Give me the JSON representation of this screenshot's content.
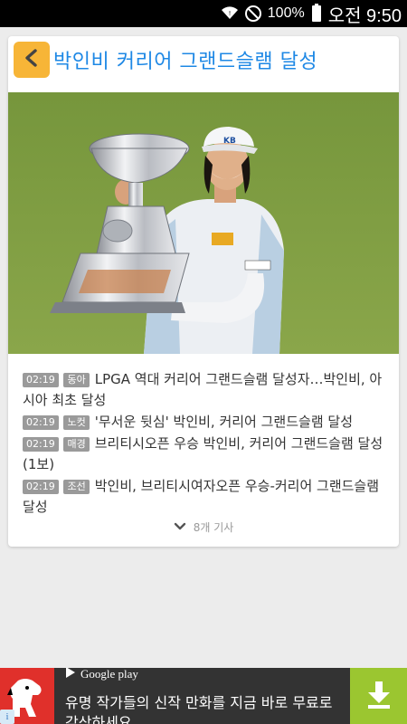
{
  "status_bar": {
    "battery_text": "100%",
    "clock": "오전 9:50",
    "icons": [
      "wifi-icon",
      "no-sim-icon",
      "battery-icon"
    ]
  },
  "card": {
    "title": "박인비 커리어 그랜드슬램 달성",
    "back_icon": "chevron-left-icon",
    "hero_image": "photo-golfer-with-trophy"
  },
  "news": [
    {
      "time": "02:19",
      "source": "동아",
      "headline": "LPGA 역대 커리어 그랜드슬램 달성자…박인비, 아시아 최초 달성"
    },
    {
      "time": "02:19",
      "source": "노컷",
      "headline": "'무서운 뒷심' 박인비, 커리어 그랜드슬램 달성"
    },
    {
      "time": "02:19",
      "source": "매경",
      "headline": "브리티시오픈 우승 박인비, 커리어 그랜드슬램 달성(1보)"
    },
    {
      "time": "02:19",
      "source": "조선",
      "headline": "박인비, 브리티시여자오픈 우승-커리어 그랜드슬램 달성"
    }
  ],
  "more": {
    "label": "8개 기사",
    "icon": "chevron-down-icon"
  },
  "ad": {
    "store_label": "Google play",
    "text": "유명 작가들의 신작 만화를 지금 바로 무료로 감상하세요",
    "download_icon": "download-icon",
    "info_label": "i"
  },
  "colors": {
    "accent_blue": "#1e88e5",
    "back_button": "#f7b537",
    "badge_gray": "#9a9a9a",
    "ad_green": "#9bc630",
    "ad_red": "#e0302b"
  }
}
